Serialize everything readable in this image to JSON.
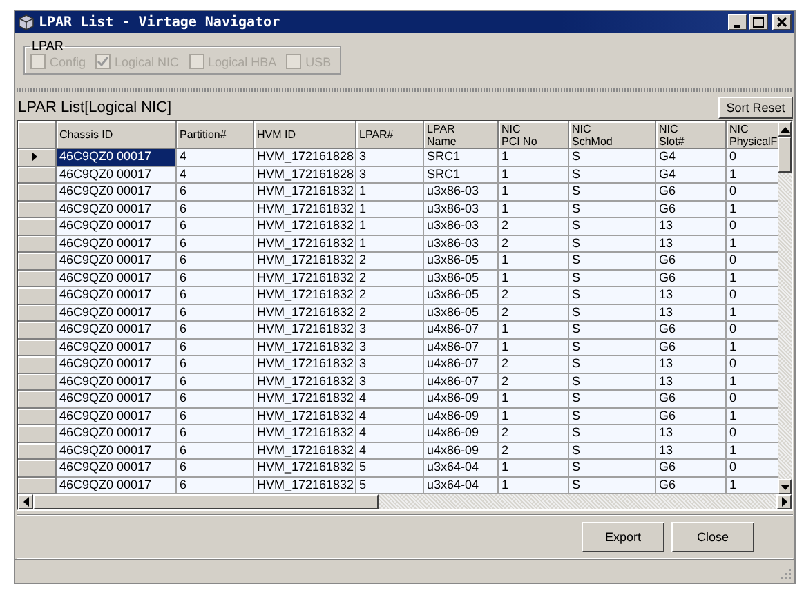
{
  "window": {
    "title": "LPAR List - Virtage Navigator"
  },
  "lpar_group": {
    "title": "LPAR",
    "options": [
      {
        "label": "Config",
        "checked": false,
        "disabled": true
      },
      {
        "label": "Logical NIC",
        "checked": true,
        "disabled": true
      },
      {
        "label": "Logical HBA",
        "checked": false,
        "disabled": true
      },
      {
        "label": "USB",
        "checked": false,
        "disabled": true
      }
    ]
  },
  "list": {
    "title": "LPAR List[Logical NIC]",
    "sort_button": "Sort Reset"
  },
  "table": {
    "columns": [
      "Chassis ID",
      "Partition#",
      "HVM ID",
      "LPAR#",
      "LPAR\nName",
      "NIC\nPCI No",
      "NIC\nSchMod",
      "NIC\nSlot#",
      "NIC\nPhysicalF"
    ],
    "rows": [
      {
        "selected": true,
        "cells": [
          "46C9QZ0 00017",
          "4",
          "HVM_172161828",
          "3",
          "SRC1",
          "1",
          "S",
          "G4",
          "0"
        ]
      },
      {
        "selected": false,
        "cells": [
          "46C9QZ0 00017",
          "4",
          "HVM_172161828",
          "3",
          "SRC1",
          "1",
          "S",
          "G4",
          "1"
        ]
      },
      {
        "selected": false,
        "cells": [
          "46C9QZ0 00017",
          "6",
          "HVM_172161832",
          "1",
          "u3x86-03",
          "1",
          "S",
          "G6",
          "0"
        ]
      },
      {
        "selected": false,
        "cells": [
          "46C9QZ0 00017",
          "6",
          "HVM_172161832",
          "1",
          "u3x86-03",
          "1",
          "S",
          "G6",
          "1"
        ]
      },
      {
        "selected": false,
        "cells": [
          "46C9QZ0 00017",
          "6",
          "HVM_172161832",
          "1",
          "u3x86-03",
          "2",
          "S",
          "13",
          "0"
        ]
      },
      {
        "selected": false,
        "cells": [
          "46C9QZ0 00017",
          "6",
          "HVM_172161832",
          "1",
          "u3x86-03",
          "2",
          "S",
          "13",
          "1"
        ]
      },
      {
        "selected": false,
        "cells": [
          "46C9QZ0 00017",
          "6",
          "HVM_172161832",
          "2",
          "u3x86-05",
          "1",
          "S",
          "G6",
          "0"
        ]
      },
      {
        "selected": false,
        "cells": [
          "46C9QZ0 00017",
          "6",
          "HVM_172161832",
          "2",
          "u3x86-05",
          "1",
          "S",
          "G6",
          "1"
        ]
      },
      {
        "selected": false,
        "cells": [
          "46C9QZ0 00017",
          "6",
          "HVM_172161832",
          "2",
          "u3x86-05",
          "2",
          "S",
          "13",
          "0"
        ]
      },
      {
        "selected": false,
        "cells": [
          "46C9QZ0 00017",
          "6",
          "HVM_172161832",
          "2",
          "u3x86-05",
          "2",
          "S",
          "13",
          "1"
        ]
      },
      {
        "selected": false,
        "cells": [
          "46C9QZ0 00017",
          "6",
          "HVM_172161832",
          "3",
          "u4x86-07",
          "1",
          "S",
          "G6",
          "0"
        ]
      },
      {
        "selected": false,
        "cells": [
          "46C9QZ0 00017",
          "6",
          "HVM_172161832",
          "3",
          "u4x86-07",
          "1",
          "S",
          "G6",
          "1"
        ]
      },
      {
        "selected": false,
        "cells": [
          "46C9QZ0 00017",
          "6",
          "HVM_172161832",
          "3",
          "u4x86-07",
          "2",
          "S",
          "13",
          "0"
        ]
      },
      {
        "selected": false,
        "cells": [
          "46C9QZ0 00017",
          "6",
          "HVM_172161832",
          "3",
          "u4x86-07",
          "2",
          "S",
          "13",
          "1"
        ]
      },
      {
        "selected": false,
        "cells": [
          "46C9QZ0 00017",
          "6",
          "HVM_172161832",
          "4",
          "u4x86-09",
          "1",
          "S",
          "G6",
          "0"
        ]
      },
      {
        "selected": false,
        "cells": [
          "46C9QZ0 00017",
          "6",
          "HVM_172161832",
          "4",
          "u4x86-09",
          "1",
          "S",
          "G6",
          "1"
        ]
      },
      {
        "selected": false,
        "cells": [
          "46C9QZ0 00017",
          "6",
          "HVM_172161832",
          "4",
          "u4x86-09",
          "2",
          "S",
          "13",
          "0"
        ]
      },
      {
        "selected": false,
        "cells": [
          "46C9QZ0 00017",
          "6",
          "HVM_172161832",
          "4",
          "u4x86-09",
          "2",
          "S",
          "13",
          "1"
        ]
      },
      {
        "selected": false,
        "cells": [
          "46C9QZ0 00017",
          "6",
          "HVM_172161832",
          "5",
          "u3x64-04",
          "1",
          "S",
          "G6",
          "0"
        ]
      },
      {
        "selected": false,
        "cells": [
          "46C9QZ0 00017",
          "6",
          "HVM_172161832",
          "5",
          "u3x64-04",
          "1",
          "S",
          "G6",
          "1"
        ]
      }
    ]
  },
  "buttons": [
    "Export",
    "Close"
  ]
}
